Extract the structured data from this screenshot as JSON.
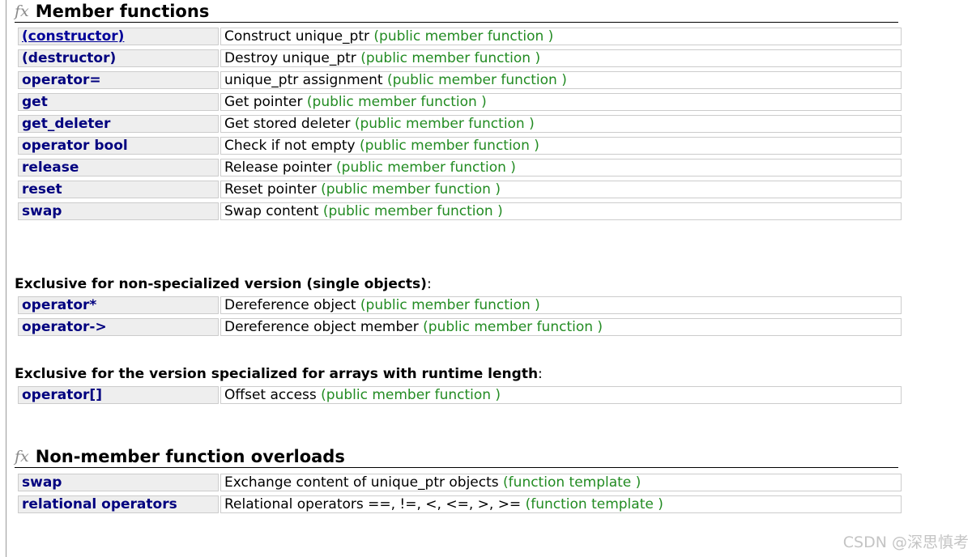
{
  "fx_icon_glyph": "fx",
  "member_functions": {
    "title": "Member functions",
    "rows": [
      {
        "name": "(constructor)",
        "desc": "Construct unique_ptr",
        "kind": "(public member function )"
      },
      {
        "name": "(destructor)",
        "desc": "Destroy unique_ptr",
        "kind": "(public member function )"
      },
      {
        "name": "operator=",
        "desc": "unique_ptr assignment",
        "kind": "(public member function )"
      },
      {
        "name": "get",
        "desc": "Get pointer",
        "kind": "(public member function )"
      },
      {
        "name": "get_deleter",
        "desc": "Get stored deleter",
        "kind": "(public member function )"
      },
      {
        "name": "operator bool",
        "desc": "Check if not empty",
        "kind": "(public member function )"
      },
      {
        "name": "release",
        "desc": "Release pointer",
        "kind": "(public member function )"
      },
      {
        "name": "reset",
        "desc": "Reset pointer",
        "kind": "(public member function )"
      },
      {
        "name": "swap",
        "desc": "Swap content",
        "kind": "(public member function )"
      }
    ]
  },
  "single_objects": {
    "title": "Exclusive for non-specialized version (single objects)",
    "colon": ":",
    "rows": [
      {
        "name": "operator*",
        "desc": "Dereference object",
        "kind": "(public member function )"
      },
      {
        "name": "operator->",
        "desc": "Dereference object member",
        "kind": "(public member function )"
      }
    ]
  },
  "arrays": {
    "title": "Exclusive for the version specialized for arrays with runtime length",
    "colon": ":",
    "rows": [
      {
        "name": "operator[]",
        "desc": "Offset access",
        "kind": "(public member function )"
      }
    ]
  },
  "non_member": {
    "title": "Non-member function overloads",
    "rows": [
      {
        "name": "swap",
        "desc": "Exchange content of unique_ptr objects",
        "kind": "(function template )"
      },
      {
        "name": "relational operators",
        "desc": "Relational operators ==, !=, <, <=, >, >=",
        "kind": "(function template )"
      }
    ]
  },
  "watermark": "CSDN @深思慎考",
  "colors": {
    "name_link": "#00007f",
    "kind_text": "#228b22",
    "name_cell_bg": "#eeeeee",
    "cell_border": "#cccccc"
  }
}
